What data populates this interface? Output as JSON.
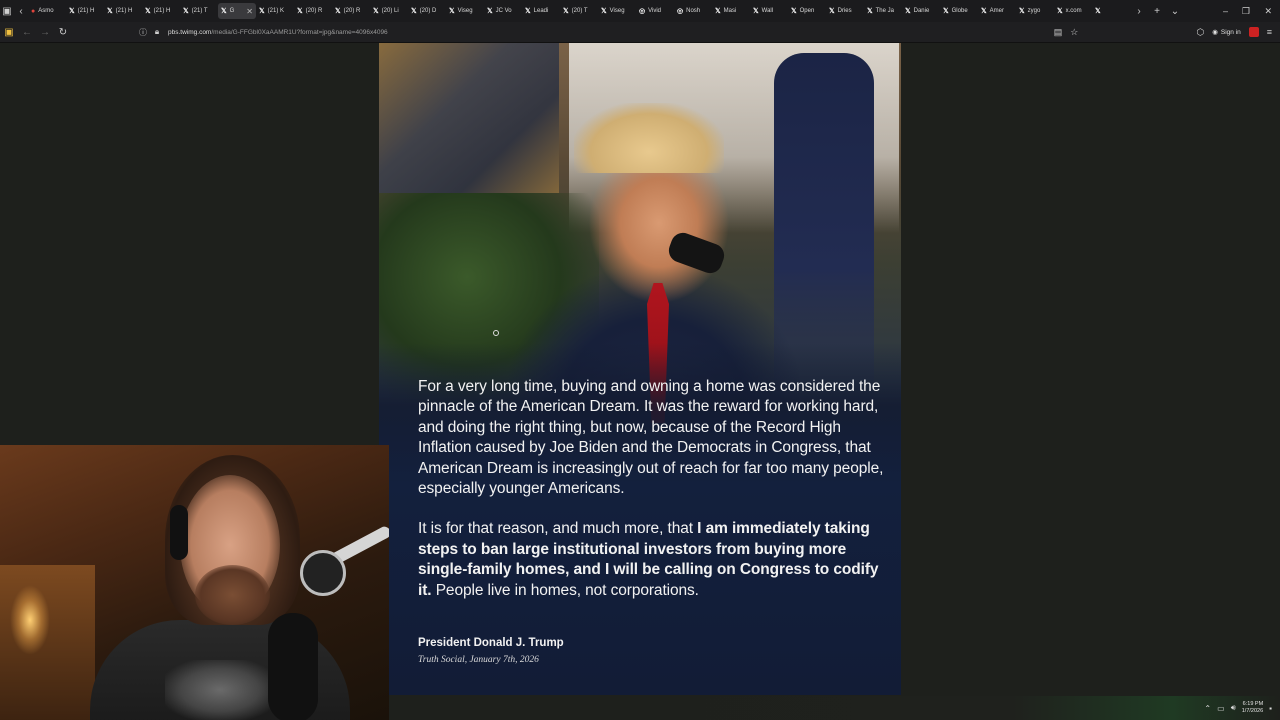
{
  "browser": {
    "tabs": [
      {
        "label": "Asmo",
        "icon": "red-circle-icon",
        "active": false
      },
      {
        "label": "(21) H",
        "icon": "x-logo-icon",
        "active": false
      },
      {
        "label": "(21) H",
        "icon": "x-logo-icon",
        "active": false
      },
      {
        "label": "(21) H",
        "icon": "x-logo-icon",
        "active": false
      },
      {
        "label": "(21) T",
        "icon": "x-logo-icon",
        "active": false
      },
      {
        "label": "G",
        "icon": "x-logo-icon",
        "active": true
      },
      {
        "label": "(21) K",
        "icon": "x-logo-icon",
        "active": false
      },
      {
        "label": "(20) R",
        "icon": "x-logo-icon",
        "active": false
      },
      {
        "label": "(20) R",
        "icon": "x-logo-icon",
        "active": false
      },
      {
        "label": "(20) Li",
        "icon": "x-logo-icon",
        "active": false
      },
      {
        "label": "(20) D",
        "icon": "x-logo-icon",
        "active": false
      },
      {
        "label": "Viseg",
        "icon": "x-logo-icon",
        "active": false
      },
      {
        "label": "JC Vo",
        "icon": "x-logo-icon",
        "active": false
      },
      {
        "label": "Leadi",
        "icon": "x-logo-icon",
        "active": false
      },
      {
        "label": "(20) T",
        "icon": "x-logo-icon",
        "active": false
      },
      {
        "label": "Viseg",
        "icon": "x-logo-icon",
        "active": false
      },
      {
        "label": "Vivid",
        "icon": "circle-icon",
        "active": false
      },
      {
        "label": "Nosh",
        "icon": "circle-icon",
        "active": false
      },
      {
        "label": "Masi",
        "icon": "x-logo-icon",
        "active": false
      },
      {
        "label": "Wall",
        "icon": "x-logo-icon",
        "active": false
      },
      {
        "label": "Open",
        "icon": "x-logo-icon",
        "active": false
      },
      {
        "label": "Dries",
        "icon": "x-logo-icon",
        "active": false
      },
      {
        "label": "The Ja",
        "icon": "x-logo-icon",
        "active": false
      },
      {
        "label": "Danie",
        "icon": "x-logo-icon",
        "active": false
      },
      {
        "label": "Globe",
        "icon": "x-logo-icon",
        "active": false
      },
      {
        "label": "Amer",
        "icon": "x-logo-icon",
        "active": false
      },
      {
        "label": "zygo",
        "icon": "x-logo-icon",
        "active": false
      },
      {
        "label": "x.com",
        "icon": "x-logo-icon",
        "active": false
      },
      {
        "label": "",
        "icon": "x-logo-icon",
        "active": false
      }
    ],
    "url_host": "pbs.twimg.com",
    "url_path": "/media/G-FFGbl0XaAAMR1U?format=jpg&name=4096x4096",
    "sign_in": "Sign in"
  },
  "post": {
    "paragraph1": "For a very long time, buying and owning a home was considered the pinnacle of the American Dream. It was the reward for working hard, and doing the right thing, but now, because of the Record High Inflation caused by Joe Biden and the Democrats in Congress, that American Dream is increasingly out of reach for far too many people, especially younger Americans.",
    "paragraph2_lead": "It is for that reason, and much more, that ",
    "paragraph2_bold": "I am immediately taking steps to ban large institutional investors from buying more single-family homes, and I will be calling on Congress to codify it.",
    "paragraph2_tail": " People live in homes, not corporations.",
    "author": "President Donald J. Trump",
    "source": "Truth Social, January 7th, 2026"
  },
  "taskbar": {
    "time": "6:19 PM",
    "date": "1/7/2026"
  }
}
